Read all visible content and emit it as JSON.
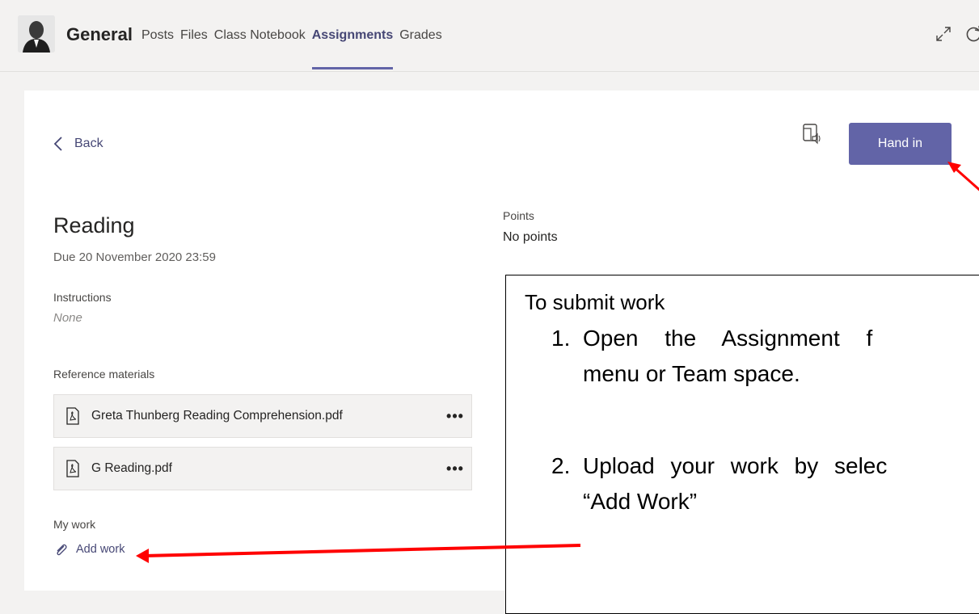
{
  "header": {
    "channel_name": "General",
    "tabs": [
      {
        "label": "Posts",
        "active": false
      },
      {
        "label": "Files",
        "active": false
      },
      {
        "label": "Class Notebook",
        "active": false
      },
      {
        "label": "Assignments",
        "active": true
      },
      {
        "label": "Grades",
        "active": false
      }
    ]
  },
  "toolbar": {
    "back_label": "Back",
    "hand_in_label": "Hand in"
  },
  "assignment": {
    "title": "Reading",
    "due": "Due 20 November 2020 23:59",
    "instructions_label": "Instructions",
    "instructions_value": "None",
    "reference_label": "Reference materials",
    "files": [
      {
        "name": "Greta Thunberg Reading Comprehension.pdf"
      },
      {
        "name": "G Reading.pdf"
      }
    ],
    "my_work_label": "My work",
    "add_work_label": "Add work",
    "points_label": "Points",
    "points_value": "No points"
  },
  "note": {
    "heading": "To submit work",
    "step1_num": "1.",
    "step1_line1": "Open the Assignment f",
    "step1_line2": "menu or Team space.",
    "step2_num": "2.",
    "step2_line1": "Upload your work by selec",
    "step2_line2": "“Add Work”"
  },
  "colors": {
    "accent": "#6264a7",
    "arrow": "#ff0000"
  },
  "icons": [
    "expand-icon",
    "refresh-icon",
    "chevron-left-icon",
    "immersive-reader-icon",
    "pdf-file-icon",
    "more-icon",
    "paperclip-icon"
  ]
}
